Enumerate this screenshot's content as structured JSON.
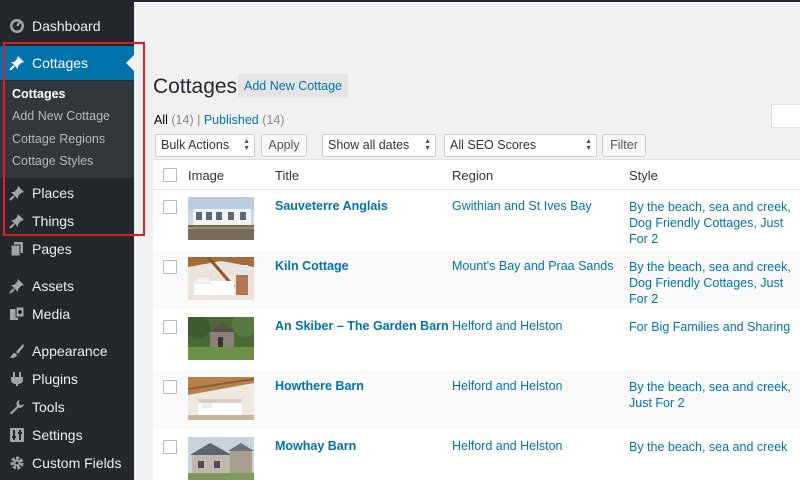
{
  "sidebar": {
    "items": [
      {
        "label": "Dashboard",
        "icon": "dashboard-icon"
      },
      {
        "label": "Cottages",
        "icon": "pin-icon"
      },
      {
        "label": "Places",
        "icon": "pin-icon"
      },
      {
        "label": "Things",
        "icon": "pin-icon"
      },
      {
        "label": "Pages",
        "icon": "pages-icon"
      },
      {
        "label": "Assets",
        "icon": "pin-icon"
      },
      {
        "label": "Media",
        "icon": "media-icon"
      },
      {
        "label": "Appearance",
        "icon": "brush-icon"
      },
      {
        "label": "Plugins",
        "icon": "plug-icon"
      },
      {
        "label": "Tools",
        "icon": "wrench-icon"
      },
      {
        "label": "Settings",
        "icon": "settings-icon"
      },
      {
        "label": "Custom Fields",
        "icon": "gear-icon"
      }
    ],
    "submenu": [
      "Cottages",
      "Add New Cottage",
      "Cottage Regions",
      "Cottage Styles"
    ]
  },
  "header": {
    "title": "Cottages",
    "add_new": "Add New Cottage"
  },
  "filters": {
    "all_label": "All",
    "all_count": "(14)",
    "separator": "|",
    "published_label": "Published",
    "published_count": "(14)"
  },
  "actions": {
    "bulk": "Bulk Actions",
    "apply": "Apply",
    "dates": "Show all dates",
    "seo": "All SEO Scores",
    "filter": "Filter"
  },
  "columns": {
    "image": "Image",
    "title": "Title",
    "region": "Region",
    "style": "Style"
  },
  "rows": [
    {
      "title": "Sauveterre Anglais",
      "region": "Gwithian and St Ives Bay",
      "style": "By the beach, sea and creek, Dog Friendly Cottages, Just For 2"
    },
    {
      "title": "Kiln Cottage",
      "region": "Mount's Bay and Praa Sands",
      "style": "By the beach, sea and creek, Dog Friendly Cottages, Just For 2"
    },
    {
      "title": "An Skiber – The Garden Barn",
      "region": "Helford and Helston",
      "style": "For Big Families and Sharing"
    },
    {
      "title": "Howthere Barn",
      "region": "Helford and Helston",
      "style": "By the beach, sea and creek, Just For 2"
    },
    {
      "title": "Mowhay Barn",
      "region": "Helford and Helston",
      "style": "By the beach, sea and creek"
    }
  ],
  "colors": {
    "accent": "#0073aa",
    "sidebar": "#23282d",
    "submenu": "#32373c",
    "highlight": "#d8202a"
  }
}
